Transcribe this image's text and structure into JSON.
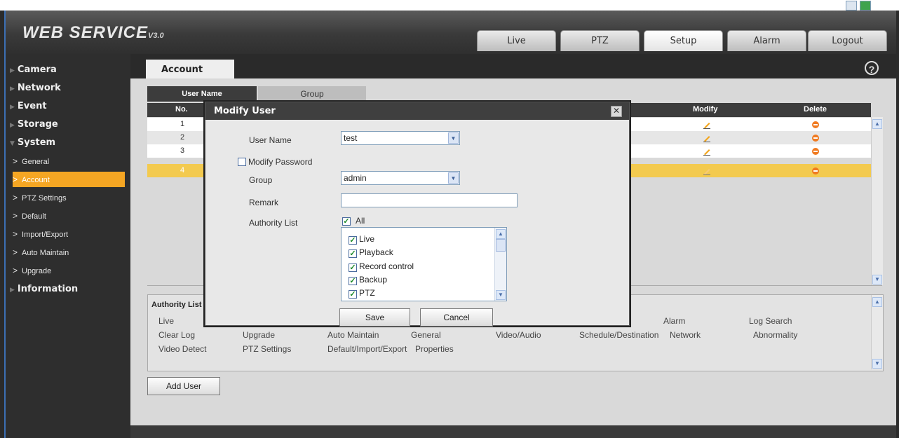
{
  "app": {
    "title": "WEB SERVICE",
    "version": "V3.0"
  },
  "nav": {
    "tabs": [
      "Live",
      "PTZ",
      "Setup",
      "Alarm",
      "Logout"
    ],
    "active": "Setup"
  },
  "sidebar": {
    "sections": [
      "Camera",
      "Network",
      "Event",
      "Storage",
      "System",
      "Information"
    ],
    "system_items": [
      "General",
      "Account",
      "PTZ Settings",
      "Default",
      "Import/Export",
      "Auto Maintain",
      "Upgrade"
    ],
    "active_item": "Account"
  },
  "page": {
    "tab": "Account",
    "help": "?"
  },
  "subtabs": {
    "user_name": "User Name",
    "group": "Group"
  },
  "table": {
    "headers": {
      "no": "No.",
      "modify": "Modify",
      "delete": "Delete"
    },
    "rows": [
      "1",
      "2",
      "3",
      "4"
    ],
    "selected_row": "4"
  },
  "authority_panel": {
    "title": "Authority List",
    "rows": [
      [
        "Live",
        "",
        "",
        "",
        "",
        "Alarm",
        "Log Search"
      ],
      [
        "Clear Log",
        "Upgrade",
        "Auto Maintain",
        "General",
        "Video/Audio",
        "Schedule/Destination",
        "Network",
        "Abnormality"
      ],
      [
        "Video Detect",
        "PTZ Settings",
        "Default/Import/Export",
        "Properties"
      ]
    ]
  },
  "add_user_label": "Add User",
  "modal": {
    "title": "Modify User",
    "user_name_label": "User Name",
    "user_name_value": "test",
    "modify_password_label": "Modify Password",
    "group_label": "Group",
    "group_value": "admin",
    "remark_label": "Remark",
    "remark_value": "",
    "authority_label": "Authority List",
    "all_label": "All",
    "authorities": [
      "Live",
      "Playback",
      "Record control",
      "Backup",
      "PTZ"
    ],
    "save_label": "Save",
    "cancel_label": "Cancel"
  },
  "colors": {
    "accent": "#f5a623",
    "header_bg": "#3f3f3f",
    "selected_row": "#f3ca4f"
  }
}
